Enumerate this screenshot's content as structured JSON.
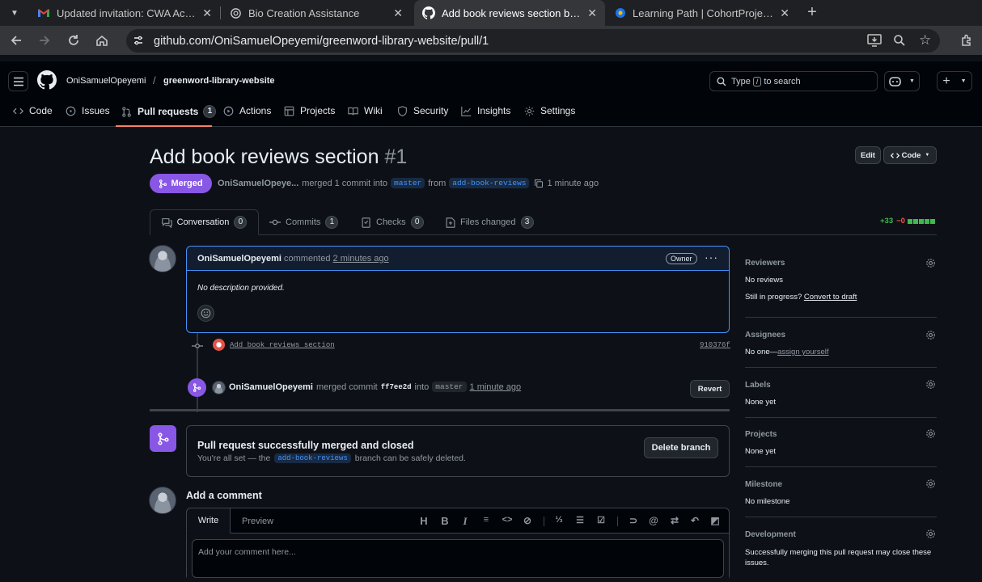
{
  "browser": {
    "tabs": [
      {
        "title": "Updated invitation: CWA Acade",
        "icon": "gmail-icon"
      },
      {
        "title": "Bio Creation Assistance",
        "icon": "openai-icon"
      },
      {
        "title": "Add book reviews section by Oni",
        "icon": "github-icon",
        "active": true
      },
      {
        "title": "Learning Path | CohortProject | I",
        "icon": "cohort-icon"
      }
    ],
    "url": "github.com/OniSamuelOpeyemi/greenword-library-website/pull/1"
  },
  "header": {
    "owner": "OniSamuelOpeyemi",
    "separator": "/",
    "repo": "greenword-library-website",
    "search_prefix": "Type",
    "search_key": "/",
    "search_suffix": "to search",
    "nav": [
      {
        "label": "Code"
      },
      {
        "label": "Issues"
      },
      {
        "label": "Pull requests",
        "count": "1"
      },
      {
        "label": "Actions"
      },
      {
        "label": "Projects"
      },
      {
        "label": "Wiki"
      },
      {
        "label": "Security"
      },
      {
        "label": "Insights"
      },
      {
        "label": "Settings"
      }
    ]
  },
  "pr": {
    "title": "Add book reviews section",
    "number": "#1",
    "edit_label": "Edit",
    "code_label": "Code",
    "state": "Merged",
    "author": "OniSamuelOpeye...",
    "merged_text": "merged 1 commit into",
    "base_branch": "master",
    "from_text": "from",
    "head_branch": "add-book-reviews",
    "time": "1 minute ago",
    "tabs": [
      {
        "label": "Conversation",
        "count": "0"
      },
      {
        "label": "Commits",
        "count": "1"
      },
      {
        "label": "Checks",
        "count": "0"
      },
      {
        "label": "Files changed",
        "count": "3"
      }
    ],
    "additions": "+33",
    "deletions": "−0"
  },
  "comment": {
    "author": "OniSamuelOpeyemi",
    "action": "commented",
    "time": "2 minutes ago",
    "badge": "Owner",
    "body": "No description provided."
  },
  "commit": {
    "message": "Add book reviews section",
    "sha": "910376f"
  },
  "merge_event": {
    "author": "OniSamuelOpeyemi",
    "text": "merged commit",
    "sha": "ff7ee2d",
    "into": "into",
    "branch": "master",
    "time": "1 minute ago",
    "revert_label": "Revert"
  },
  "merged_box": {
    "title": "Pull request successfully merged and closed",
    "line_before": "You're all set — the",
    "branch": "add-book-reviews",
    "line_after": "branch can be safely deleted.",
    "delete_label": "Delete branch"
  },
  "add_comment": {
    "title": "Add a comment",
    "write_tab": "Write",
    "preview_tab": "Preview",
    "placeholder": "Add your comment here..."
  },
  "sidebar": {
    "reviewers": {
      "title": "Reviewers",
      "value": "No reviews",
      "draft_text": "Still in progress?",
      "draft_link": "Convert to draft"
    },
    "assignees": {
      "title": "Assignees",
      "value": "No one—",
      "link": "assign yourself"
    },
    "labels": {
      "title": "Labels",
      "value": "None yet"
    },
    "projects": {
      "title": "Projects",
      "value": "None yet"
    },
    "milestone": {
      "title": "Milestone",
      "value": "No milestone"
    },
    "development": {
      "title": "Development",
      "value": "Successfully merging this pull request may close these issues."
    }
  },
  "colors": {
    "merged": "#8957e5",
    "accent": "#4493f8",
    "additions": "#3fb950",
    "deletions": "#f85149"
  }
}
